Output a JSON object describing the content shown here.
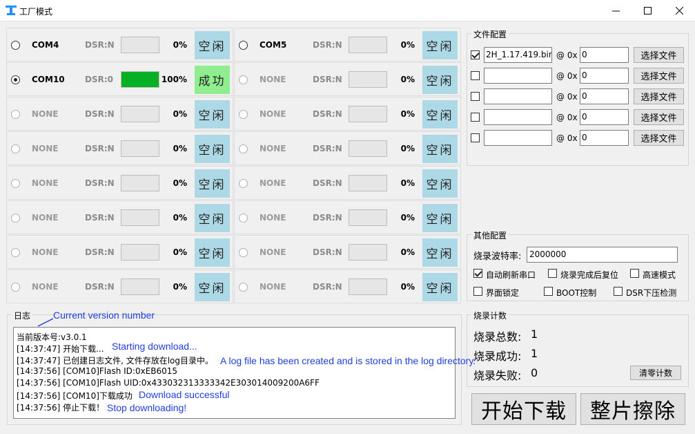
{
  "window": {
    "title": "工厂模式"
  },
  "ports": [
    {
      "name": "COM4",
      "dsr": "DSR:N",
      "percent": "0%",
      "progress": 0,
      "status": "空闲",
      "selected": false,
      "dim": false,
      "ok": false
    },
    {
      "name": "COM5",
      "dsr": "DSR:N",
      "percent": "0%",
      "progress": 0,
      "status": "空闲",
      "selected": false,
      "dim": false,
      "ok": false
    },
    {
      "name": "COM10",
      "dsr": "DSR:0",
      "percent": "100%",
      "progress": 100,
      "status": "成功",
      "selected": true,
      "dim": false,
      "ok": true
    },
    {
      "name": "NONE",
      "dsr": "DSR:N",
      "percent": "0%",
      "progress": 0,
      "status": "空闲",
      "selected": false,
      "dim": true,
      "ok": false
    },
    {
      "name": "NONE",
      "dsr": "DSR:N",
      "percent": "0%",
      "progress": 0,
      "status": "空闲",
      "selected": false,
      "dim": true,
      "ok": false
    },
    {
      "name": "NONE",
      "dsr": "DSR:N",
      "percent": "0%",
      "progress": 0,
      "status": "空闲",
      "selected": false,
      "dim": true,
      "ok": false
    },
    {
      "name": "NONE",
      "dsr": "DSR:N",
      "percent": "0%",
      "progress": 0,
      "status": "空闲",
      "selected": false,
      "dim": true,
      "ok": false
    },
    {
      "name": "NONE",
      "dsr": "DSR:N",
      "percent": "0%",
      "progress": 0,
      "status": "空闲",
      "selected": false,
      "dim": true,
      "ok": false
    },
    {
      "name": "NONE",
      "dsr": "DSR:N",
      "percent": "0%",
      "progress": 0,
      "status": "空闲",
      "selected": false,
      "dim": true,
      "ok": false
    },
    {
      "name": "NONE",
      "dsr": "DSR:N",
      "percent": "0%",
      "progress": 0,
      "status": "空闲",
      "selected": false,
      "dim": true,
      "ok": false
    },
    {
      "name": "NONE",
      "dsr": "DSR:N",
      "percent": "0%",
      "progress": 0,
      "status": "空闲",
      "selected": false,
      "dim": true,
      "ok": false
    },
    {
      "name": "NONE",
      "dsr": "DSR:N",
      "percent": "0%",
      "progress": 0,
      "status": "空闲",
      "selected": false,
      "dim": true,
      "ok": false
    },
    {
      "name": "NONE",
      "dsr": "DSR:N",
      "percent": "0%",
      "progress": 0,
      "status": "空闲",
      "selected": false,
      "dim": true,
      "ok": false
    },
    {
      "name": "NONE",
      "dsr": "DSR:N",
      "percent": "0%",
      "progress": 0,
      "status": "空闲",
      "selected": false,
      "dim": true,
      "ok": false
    },
    {
      "name": "NONE",
      "dsr": "DSR:N",
      "percent": "0%",
      "progress": 0,
      "status": "空闲",
      "selected": false,
      "dim": true,
      "ok": false
    },
    {
      "name": "NONE",
      "dsr": "DSR:N",
      "percent": "0%",
      "progress": 0,
      "status": "空闲",
      "selected": false,
      "dim": true,
      "ok": false
    }
  ],
  "file_config": {
    "label": "文件配置",
    "at_label": "@ 0x",
    "button_label": "选择文件",
    "rows": [
      {
        "checked": true,
        "path": "2H_1.17.419.bin",
        "address": "0"
      },
      {
        "checked": false,
        "path": "",
        "address": "0"
      },
      {
        "checked": false,
        "path": "",
        "address": "0"
      },
      {
        "checked": false,
        "path": "",
        "address": "0"
      },
      {
        "checked": false,
        "path": "",
        "address": "0"
      }
    ]
  },
  "other_config": {
    "label": "其他配置",
    "baud_label": "烧录波特率:",
    "baud_value": "2000000",
    "options": [
      {
        "label": "自动刷新串口",
        "checked": true
      },
      {
        "label": "烧录完成后复位",
        "checked": false
      },
      {
        "label": "高速模式",
        "checked": false
      },
      {
        "label": "界面锁定",
        "checked": false
      },
      {
        "label": "BOOT控制",
        "checked": false
      },
      {
        "label": "DSR下压检测",
        "checked": false
      }
    ]
  },
  "count": {
    "label": "烧录计数",
    "total_label": "烧录总数:",
    "total": "1",
    "success_label": "烧录成功:",
    "success": "1",
    "fail_label": "烧录失败:",
    "fail": "0",
    "clear_label": "清零计数"
  },
  "actions": {
    "start_label": "开始下载",
    "erase_label": "整片擦除"
  },
  "log": {
    "label": "日志",
    "lines": [
      "当前版本号:v3.0.1",
      "[14:37:47] 开始下载...",
      "[14:37:47] 已创建日志文件, 文件存放在log目录中。",
      "[14:37:56] [COM10]Flash ID:0xEB6015",
      "[14:37:56] [COM10]Flash UID:0x433032313333342E303014009200A6FF",
      "[14:37:56] [COM10]下载成功",
      "[14:37:56] 停止下载！"
    ]
  },
  "annotations": {
    "version": "Current version number",
    "start": "Starting download...",
    "logfile": "A log file has been created and is stored in the log directory.",
    "success": "Download successful",
    "stop": "Stop downloading!"
  },
  "colors": {
    "idle": "#add8e6",
    "success": "#90ee90",
    "progress": "#06b025",
    "annotation": "#1f3fdf"
  }
}
